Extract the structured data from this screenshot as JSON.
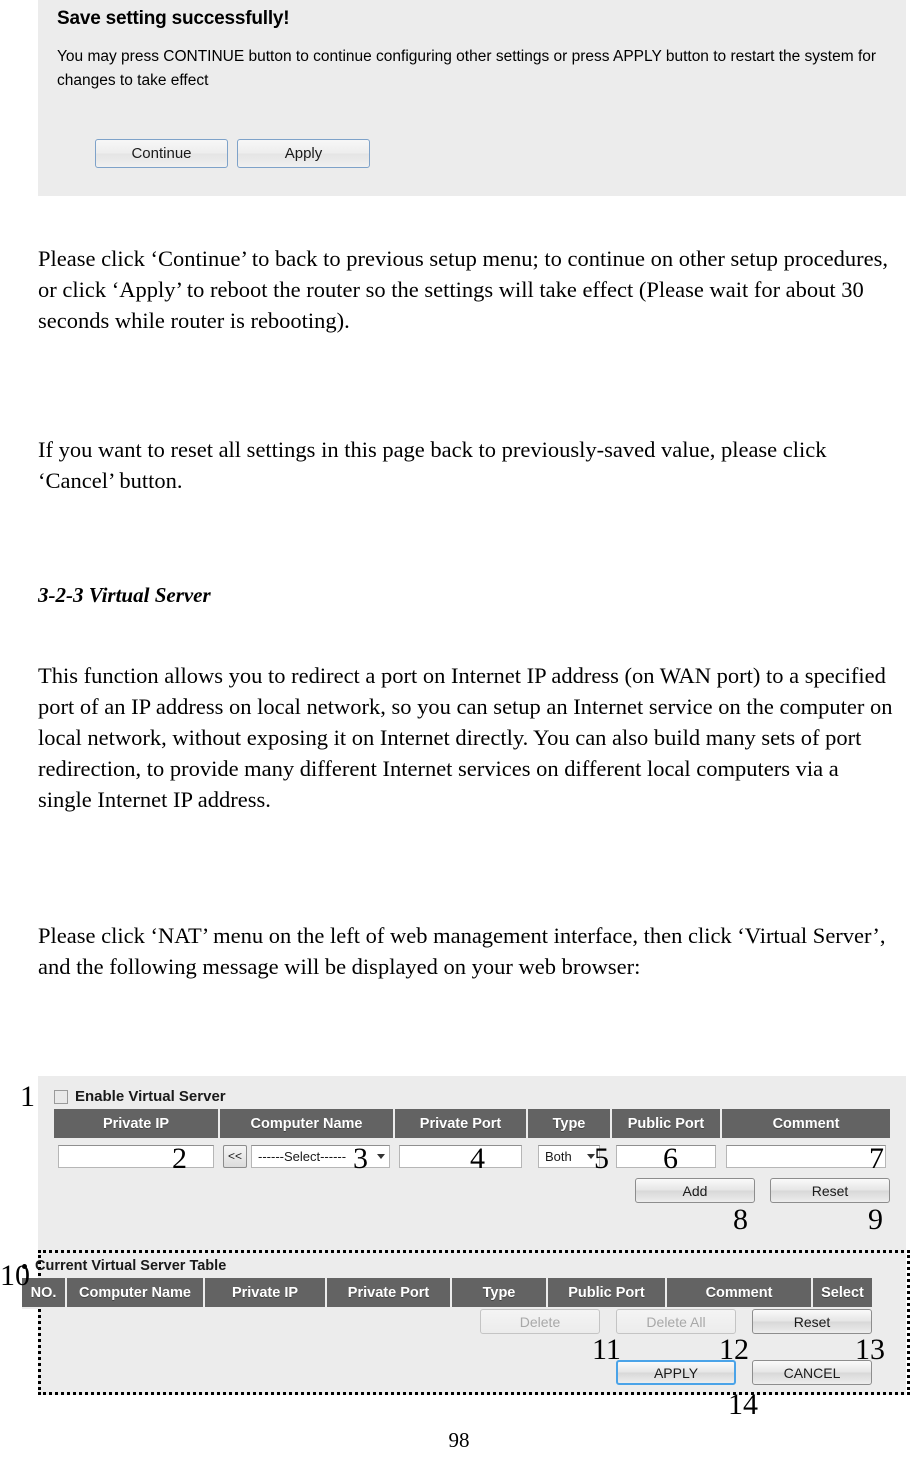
{
  "top_panel": {
    "title": "Save setting successfully!",
    "description": "You may press CONTINUE button to continue configuring other settings or press APPLY button to restart the system for changes to take effect",
    "buttons": {
      "continue": "Continue",
      "apply": "Apply"
    }
  },
  "prose": {
    "p1": "Please click ‘Continue’ to back to previous setup menu; to continue on other setup procedures, or click ‘Apply’ to reboot the router so the settings will take effect (Please wait for about 30 seconds while router is rebooting).",
    "p2": "If you want to reset all settings in this page back to previously-saved value, please click ‘Cancel’ button.",
    "heading": "3-2-3 Virtual Server",
    "p3": "This function allows you to redirect a port on Internet IP address (on WAN port) to a specified port of an IP address on local network, so you can setup an Internet service on the computer on local network, without exposing it on Internet directly. You can also build many sets of port redirection, to provide many different Internet services on different local computers via a single Internet IP address.",
    "p4": "Please click ‘NAT’ menu on the left of web management interface, then click ‘Virtual Server’, and the following message will be displayed on your web browser:"
  },
  "virtual_server": {
    "enable_label": "Enable Virtual Server",
    "enable_checked": false,
    "input_table": {
      "headers": [
        "Private IP",
        "Computer Name",
        "Private Port",
        "Type",
        "Public Port",
        "Comment"
      ],
      "values": {
        "private_ip": "",
        "select_button": "<<",
        "computer_name": "------Select------",
        "private_port": "",
        "type": "Both",
        "public_port": "",
        "comment": ""
      }
    },
    "input_buttons": {
      "add": "Add",
      "reset": "Reset"
    },
    "current_table": {
      "title": "Current Virtual Server Table",
      "headers": [
        "NO.",
        "Computer Name",
        "Private IP",
        "Private Port",
        "Type",
        "Public Port",
        "Comment",
        "Select"
      ],
      "rows": []
    },
    "table_buttons": {
      "delete": "Delete",
      "delete_all": "Delete All",
      "reset": "Reset",
      "apply": "APPLY",
      "cancel": "CANCEL"
    }
  },
  "callouts": {
    "c1": "1",
    "c2": "2",
    "c3": "3",
    "c4": "4",
    "c5": "5",
    "c6": "6",
    "c7": "7",
    "c8": "8",
    "c9": "9",
    "c10": "10",
    "c11": "11",
    "c12": "12",
    "c13": "13",
    "c14": "14"
  },
  "page_number": "98",
  "colors": {
    "panel_bg": "#ececec",
    "table_header": "#636363",
    "focus_blue": "#4aa3e8",
    "button_border_blue": "#7ea2c9"
  }
}
